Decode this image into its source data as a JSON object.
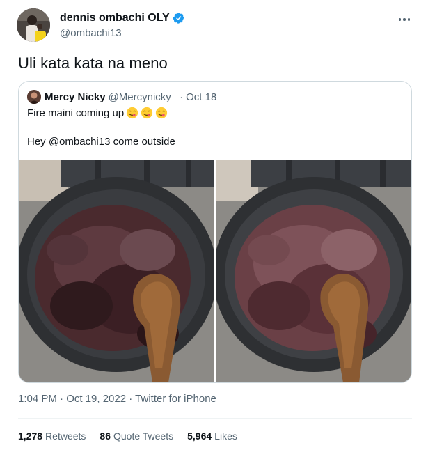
{
  "tweet": {
    "author": {
      "display_name": "dennis ombachi OLY",
      "handle": "@ombachi13",
      "verified": true
    },
    "text": "Uli kata kata na meno",
    "more_icon": "more-horizontal-icon",
    "quoted": {
      "display_name": "Mercy Nicky",
      "handle": "@Mercynicky_",
      "separator": "·",
      "date": "Oct 18",
      "line1": "Fire maini coming up",
      "emoji": [
        "face-savoring-food-emoji",
        "face-savoring-food-emoji",
        "face-savoring-food-emoji"
      ],
      "line2": "Hey @ombachi13 come outside"
    },
    "timestamp": "1:04 PM · Oct 19, 2022 · ",
    "source": "Twitter for iPhone",
    "stats": [
      {
        "count": "1,278",
        "label": "Retweets"
      },
      {
        "count": "86",
        "label": "Quote Tweets"
      },
      {
        "count": "5,964",
        "label": "Likes"
      }
    ]
  },
  "colors": {
    "verified_badge": "#1d9bf0",
    "secondary_text": "#536471",
    "border": "#cfd9de"
  }
}
